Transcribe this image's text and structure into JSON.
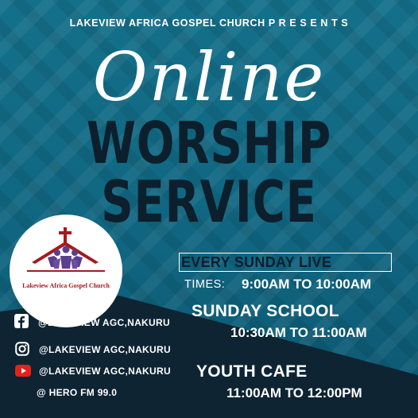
{
  "poster": {
    "header": "LAKEVIEW AFRICA GOSPEL CHURCH P R E S E N T S",
    "title_script": "Online",
    "title_line1": "WORSHIP",
    "title_line2": "SERVICE"
  },
  "logo": {
    "text": "Lakeview Africa Gospel Church"
  },
  "schedule": {
    "every": "EVERY SUNDAY LIVE",
    "times_label": "TIMES:",
    "times_value": "9:00AM TO 10:00AM",
    "sunday_school_title": "SUNDAY SCHOOL",
    "sunday_school_time": "10:30AM TO 11:00AM",
    "youth_cafe_title": "YOUTH CAFE",
    "youth_cafe_time": "11:00AM TO 12:00PM"
  },
  "social": {
    "facebook": "@LAKEVIEW AGC,NAKURU",
    "instagram": "@LAKEVIEW AGC,NAKURU",
    "youtube": "@LAKEVIEW AGC,NAKURU",
    "radio": "@ HERO FM 99.0"
  },
  "colors": {
    "background_teal": "#14708a",
    "dark_band": "#0e2433",
    "title_dark": "#0b1f2c",
    "logo_red": "#a51a1f",
    "logo_purple": "#5b3f8f",
    "youtube_red": "#e62117"
  },
  "icons": {
    "facebook": "facebook-icon",
    "instagram": "instagram-icon",
    "youtube": "youtube-icon"
  }
}
